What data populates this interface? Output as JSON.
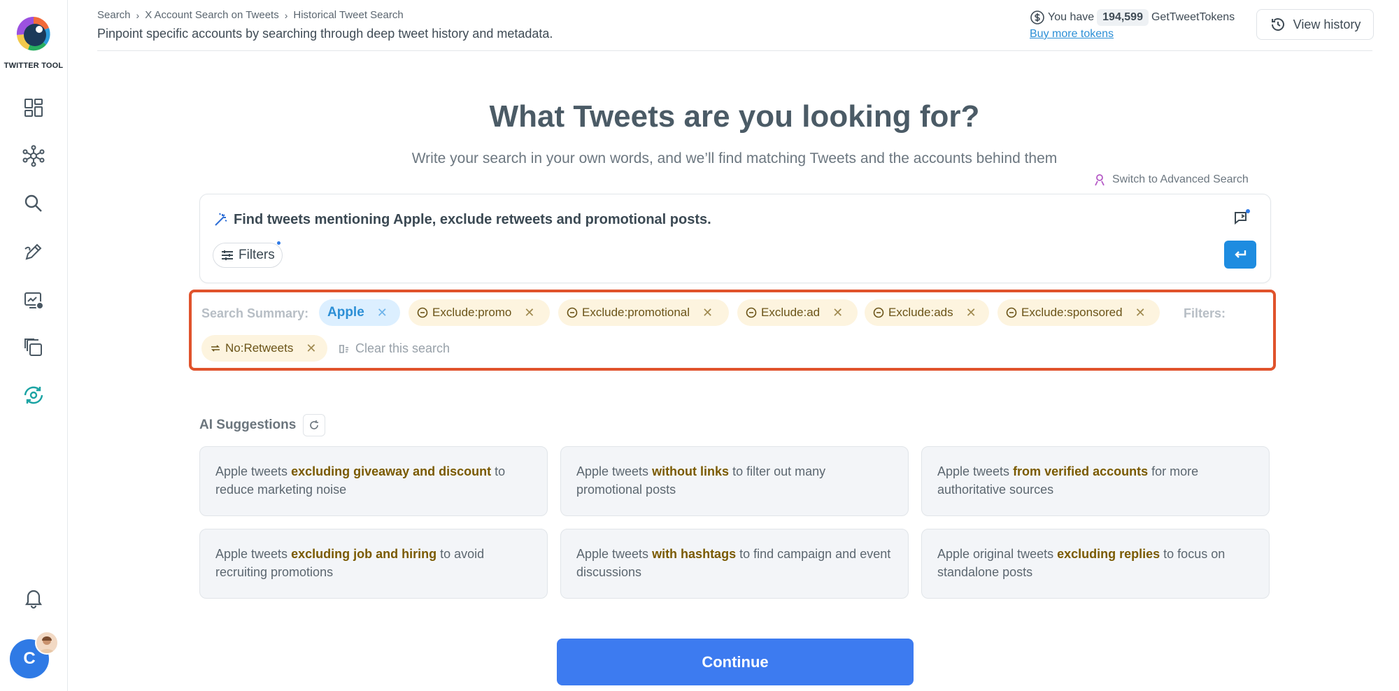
{
  "sidebar": {
    "brand": "TWITTER TOOL",
    "avatar_initial": "C",
    "items": [
      {
        "icon": "dashboard-icon"
      },
      {
        "icon": "network-icon"
      },
      {
        "icon": "search-icon"
      },
      {
        "icon": "edit-pen-icon"
      },
      {
        "icon": "analytics-icon"
      },
      {
        "icon": "copy-icon"
      },
      {
        "icon": "sync-icon"
      }
    ]
  },
  "header": {
    "breadcrumbs": [
      "Search",
      "X Account Search on Tweets",
      "Historical Tweet Search"
    ],
    "subtitle": "Pinpoint specific accounts by searching through deep tweet history and metadata.",
    "tokens_prefix": "You have",
    "tokens_count": "194,599",
    "tokens_suffix": "GetTweetTokens",
    "buy_link": "Buy more tokens",
    "history_button": "View history"
  },
  "hero": {
    "title": "What Tweets are you looking for?",
    "subtitle": "Write your search in your own words, and we’ll find matching Tweets and the accounts behind them",
    "advanced_link": "Switch to Advanced Search"
  },
  "search": {
    "query": "Find tweets mentioning Apple, exclude retweets and promotional posts.",
    "filters_label": "Filters"
  },
  "summary": {
    "label": "Search Summary:",
    "keyword": "Apple",
    "excludes": [
      "Exclude:promo",
      "Exclude:promotional",
      "Exclude:ad",
      "Exclude:ads",
      "Exclude:sponsored"
    ],
    "filters_label": "Filters:",
    "filter_chip": "No:Retweets",
    "clear": "Clear this search"
  },
  "suggestions": {
    "title": "AI Suggestions",
    "cards": [
      {
        "pre": "Apple tweets ",
        "bold": "excluding giveaway and discount",
        "post": " to reduce marketing noise"
      },
      {
        "pre": "Apple tweets ",
        "bold": "without links",
        "post": " to filter out many promotional posts"
      },
      {
        "pre": "Apple tweets ",
        "bold": "from verified accounts",
        "post": " for more authoritative sources"
      },
      {
        "pre": "Apple tweets ",
        "bold": "excluding job and hiring",
        "post": " to avoid recruiting promotions"
      },
      {
        "pre": "Apple tweets ",
        "bold": "with hashtags",
        "post": " to find campaign and event discussions"
      },
      {
        "pre": "Apple original tweets ",
        "bold": "excluding replies",
        "post": " to focus on standalone posts"
      }
    ]
  },
  "continue_label": "Continue",
  "colors": {
    "accent": "#3d7bf0",
    "highlight_border": "#e0532c",
    "chip_amber": "#fdf4df",
    "chip_blue": "#dcefff"
  }
}
